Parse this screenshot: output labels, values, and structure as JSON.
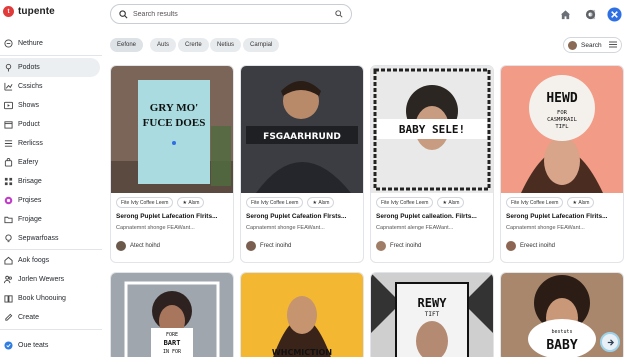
{
  "app": {
    "logo_glyph": "t",
    "name": "tupente"
  },
  "search": {
    "placeholder": "Search results"
  },
  "sidebar": {
    "items": [
      {
        "label": "Nethure",
        "icon": "circle-minus-icon"
      },
      {
        "label": "Podots",
        "icon": "pin-icon"
      },
      {
        "label": "Cssichs",
        "icon": "chart-icon"
      },
      {
        "label": "Shows",
        "icon": "play-icon"
      },
      {
        "label": "Poduct",
        "icon": "box-icon"
      },
      {
        "label": "Rerlicss",
        "icon": "list-icon"
      },
      {
        "label": "Eafery",
        "icon": "bag-icon"
      },
      {
        "label": "Brisage",
        "icon": "grid-icon"
      },
      {
        "label": "Prqises",
        "icon": "badge-icon"
      },
      {
        "label": "Frojage",
        "icon": "folder-icon"
      },
      {
        "label": "Sepwarfoass",
        "icon": "bulb-icon"
      },
      {
        "label": "Aok foogs",
        "icon": "home-icon"
      },
      {
        "label": "Jorlen Wewers",
        "icon": "people-icon"
      },
      {
        "label": "Book Uhoouing",
        "icon": "book-icon"
      },
      {
        "label": "Create",
        "icon": "pen-icon"
      },
      {
        "label": "Oue teats",
        "icon": "check-circle-icon"
      }
    ]
  },
  "filters": [
    "Eefone",
    "Auts",
    "Crerte",
    "Netius",
    "Carnpial"
  ],
  "right_search": {
    "label": "Search"
  },
  "cards": [
    {
      "poster_text": "GRY MO' FUCE DOES",
      "tags": [
        "Fite Ivty Coffee Leem",
        "Alsm"
      ],
      "title": "Serong Puplet Lafecation Flrits...",
      "subtitle": "Capnatemnt shonge FEAWant...",
      "author": "Atect hoihd",
      "colors": {
        "bg": "#7b6558",
        "poster": "#a9dbe0"
      }
    },
    {
      "poster_text": "FSGAARHRUND",
      "tags": [
        "Fite Ivty Coffee Leem",
        "Alsm"
      ],
      "title": "Serong Puplet Cafeation Flrsts...",
      "subtitle": "Capnatemnt shonge FEAWant...",
      "author": "Frect inoihd",
      "colors": {
        "bg": "#3b3d42",
        "poster": "#1f2024"
      }
    },
    {
      "poster_text": "BABY SELE!",
      "tags": [
        "Fite Ivty Coffee Leem",
        "Alsm"
      ],
      "title": "Serong Puplet calleation. Filrts...",
      "subtitle": "Capnatemnt alenge FEAWant...",
      "author": "Frect inoihd",
      "colors": {
        "bg": "#e9e9e9",
        "poster": "#ffffff"
      }
    },
    {
      "poster_text": "HEWD",
      "poster_small": "FOR CASMPRAIL TIFL",
      "tags": [
        "Fite Ivty Coffee Leem",
        "Alsm"
      ],
      "title": "Serong Puplet Lafecation Flrits...",
      "subtitle": "Capnatemnt shonge FEAWant...",
      "author": "Ereect inoihd",
      "colors": {
        "bg": "#f29b86",
        "poster": "#f4f1ec"
      }
    }
  ],
  "bottom_cards": [
    {
      "poster_text": "FORE BART IN FOR",
      "colors": {
        "bg": "#9fa6ad"
      }
    },
    {
      "poster_text": "WHCMICTION",
      "colors": {
        "bg": "#f4b731"
      }
    },
    {
      "poster_text": "REWY",
      "poster_small": "TIFT",
      "colors": {
        "bg": "#cfcfcf"
      }
    },
    {
      "poster_text": "BABY",
      "poster_small": "bestuts",
      "colors": {
        "bg": "#a9876c"
      }
    }
  ]
}
